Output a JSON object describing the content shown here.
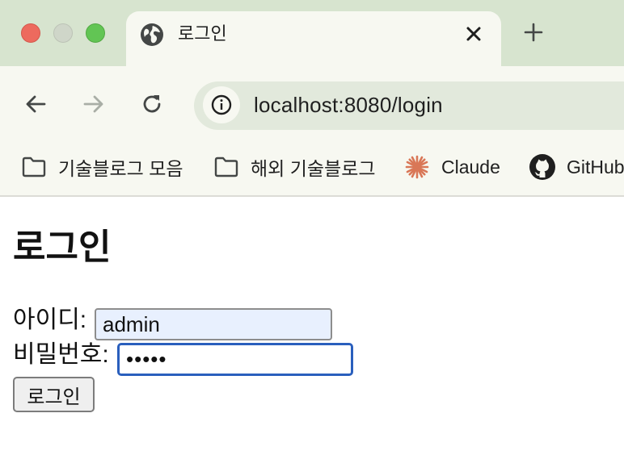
{
  "window": {
    "controls": {
      "close": "#ed6a5e",
      "minimize": "#cfd6c9",
      "maximize": "#62c554"
    }
  },
  "tab": {
    "title": "로그인",
    "icon": "globe-icon"
  },
  "toolbar": {
    "url": "localhost:8080/login"
  },
  "bookmarks": [
    {
      "label": "기술블로그 모음",
      "icon": "folder-icon"
    },
    {
      "label": "해외 기술블로그",
      "icon": "folder-icon"
    },
    {
      "label": "Claude",
      "icon": "claude-icon"
    },
    {
      "label": "GitHub",
      "icon": "github-icon"
    }
  ],
  "page": {
    "heading": "로그인",
    "id_label": "아이디:",
    "id_value": "admin",
    "pw_label": "비밀번호:",
    "pw_value": "•••••",
    "submit_label": "로그인"
  },
  "colors": {
    "tabstrip": "#d7e4cf",
    "chrome": "#f7f8f1",
    "omnibox": "#e2e9dc",
    "focus_ring": "#2a5fbd",
    "autofill": "#e8f0fe"
  }
}
